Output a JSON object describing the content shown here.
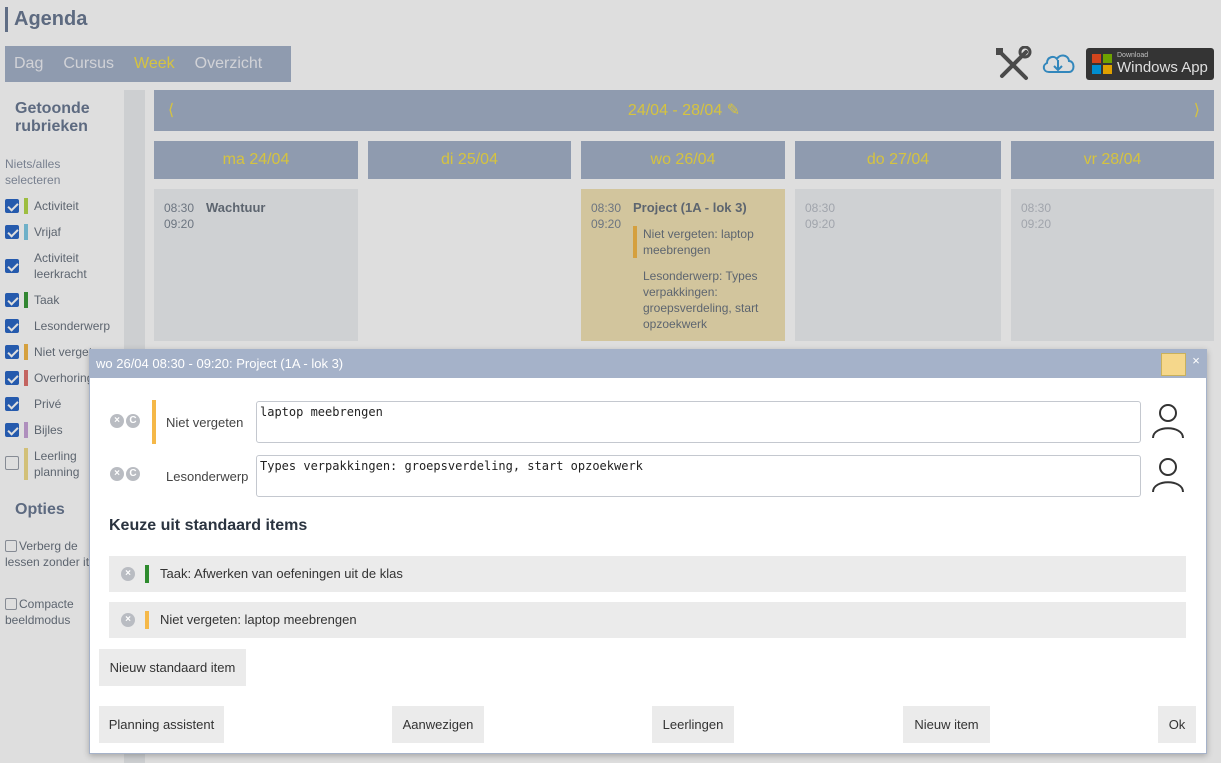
{
  "app": {
    "title": "Agenda"
  },
  "nav": {
    "tabs": [
      "Dag",
      "Cursus",
      "Week",
      "Overzicht"
    ],
    "active": "Week"
  },
  "toolbar": {
    "windows_small": "Download",
    "windows_big": "Windows App"
  },
  "sidebar": {
    "heading": "Getoonde rubrieken",
    "select_hint": "Niets/alles selecteren",
    "categories": [
      {
        "label": "Activiteit",
        "checked": true,
        "color": "#b5d94a"
      },
      {
        "label": "Vrijaf",
        "checked": true,
        "color": "#7fcbe6"
      },
      {
        "label": "Activiteit leerkracht",
        "checked": true,
        "color": null
      },
      {
        "label": "Taak",
        "checked": true,
        "color": "#3a9a3a"
      },
      {
        "label": "Lesonderwerp",
        "checked": true,
        "color": null
      },
      {
        "label": "Niet vergeten",
        "checked": true,
        "color": "#f5b848"
      },
      {
        "label": "Overhoring",
        "checked": true,
        "color": "#e0736f"
      },
      {
        "label": "Privé",
        "checked": true,
        "color": null
      },
      {
        "label": "Bijles",
        "checked": true,
        "color": "#c9a5d9"
      },
      {
        "label": "Leerling planning",
        "checked": false,
        "color": "#f2dd8a"
      }
    ],
    "options_heading": "Opties",
    "options": [
      {
        "label": "Verberg de lessen zonder items",
        "checked": false
      },
      {
        "label": "Compacte beeldmodus",
        "checked": false
      }
    ]
  },
  "week": {
    "prev": "⟨",
    "range": "24/04 - 28/04",
    "next": "⟩"
  },
  "days": [
    {
      "label": "ma 24/04"
    },
    {
      "label": "di 25/04"
    },
    {
      "label": "wo 26/04"
    },
    {
      "label": "do 27/04"
    },
    {
      "label": "vr 28/04"
    }
  ],
  "events": {
    "mon": {
      "start": "08:30",
      "end": "09:20",
      "title": "Wachtuur"
    },
    "wed": {
      "start": "08:30",
      "end": "09:20",
      "title": "Project (1A - lok 3)",
      "note": "Niet vergeten: laptop meebrengen",
      "subject": "Lesonderwerp: Types verpakkingen: groepsverdeling, start opzoekwerk"
    },
    "thu": {
      "start": "08:30",
      "end": "09:20"
    },
    "fri": {
      "start": "08:30",
      "end": "09:20"
    }
  },
  "dialog": {
    "title": "wo 26/04 08:30 - 09:20: Project (1A - lok 3)",
    "close": "×",
    "swatch_color": "#f5d78b",
    "fields": [
      {
        "label": "Niet vergeten",
        "value": "laptop meebrengen",
        "color": "#f5b848"
      },
      {
        "label": "Lesonderwerp",
        "value": "Types verpakkingen: groepsverdeling, start opzoekwerk",
        "color": null
      }
    ],
    "std_heading": "Keuze uit standaard items",
    "std_items": [
      {
        "label": "Taak: Afwerken van oefeningen uit de klas",
        "color": "#2e8b2e"
      },
      {
        "label": "Niet vergeten: laptop meebrengen",
        "color": "#f5b848"
      }
    ],
    "btn_new_std": "Nieuw standaard item",
    "btn_planning": "Planning assistent",
    "btn_present": "Aanwezigen",
    "btn_students": "Leerlingen",
    "btn_new_item": "Nieuw item",
    "btn_ok": "Ok"
  }
}
